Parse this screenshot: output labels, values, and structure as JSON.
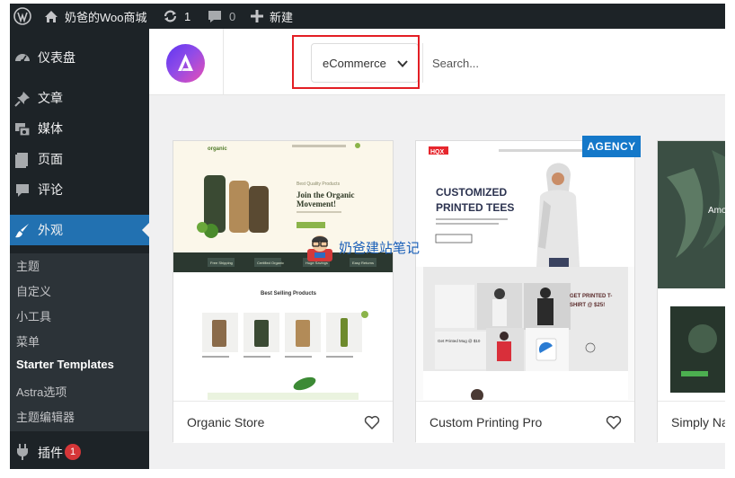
{
  "admin_bar": {
    "site_name": "奶爸的Woo商城",
    "updates_count": "1",
    "comments_count": "0",
    "new_label": "新建"
  },
  "sidebar": {
    "items": [
      {
        "label": "仪表盘",
        "icon": "dashboard-icon"
      },
      {
        "label": "文章",
        "icon": "pin-icon"
      },
      {
        "label": "媒体",
        "icon": "media-icon"
      },
      {
        "label": "页面",
        "icon": "page-icon"
      },
      {
        "label": "评论",
        "icon": "comment-icon"
      },
      {
        "label": "外观",
        "icon": "brush-icon",
        "active": true
      }
    ],
    "submenu": [
      "主题",
      "自定义",
      "小工具",
      "菜单",
      "Starter Templates",
      "Astra选项",
      "主题编辑器"
    ],
    "submenu_current": "Starter Templates",
    "plugins": {
      "label": "插件",
      "badge": "1"
    }
  },
  "header": {
    "category_select": "eCommerce",
    "search_placeholder": "Search..."
  },
  "cards": [
    {
      "title": "Organic Store",
      "thumb": {
        "brand": "organic",
        "tagline": "Best Quality Products",
        "headline": "Join the Organic Movement!",
        "features": [
          "Free Shipping",
          "Certified Organic",
          "Huge Savings",
          "Easy Returns"
        ],
        "section_title": "Best Selling Products"
      }
    },
    {
      "title": "Custom Printing Pro",
      "tag": "AGENCY",
      "thumb": {
        "brand": "HQX",
        "headline_1": "CUSTOMIZED",
        "headline_2": "PRINTED TEES",
        "promo": "GET PRINTED T-SHIRT @ $25!",
        "mug_text": "Get Printed Mug @ $10"
      }
    },
    {
      "title": "Simply Na",
      "thumb": {
        "text": "Amo"
      }
    }
  ],
  "watermark": "奶爸建站笔记",
  "colors": {
    "admin_bg": "#1d2327",
    "active_blue": "#2271b1",
    "highlight_red": "#e31e24",
    "tag_blue": "#1478c9"
  }
}
